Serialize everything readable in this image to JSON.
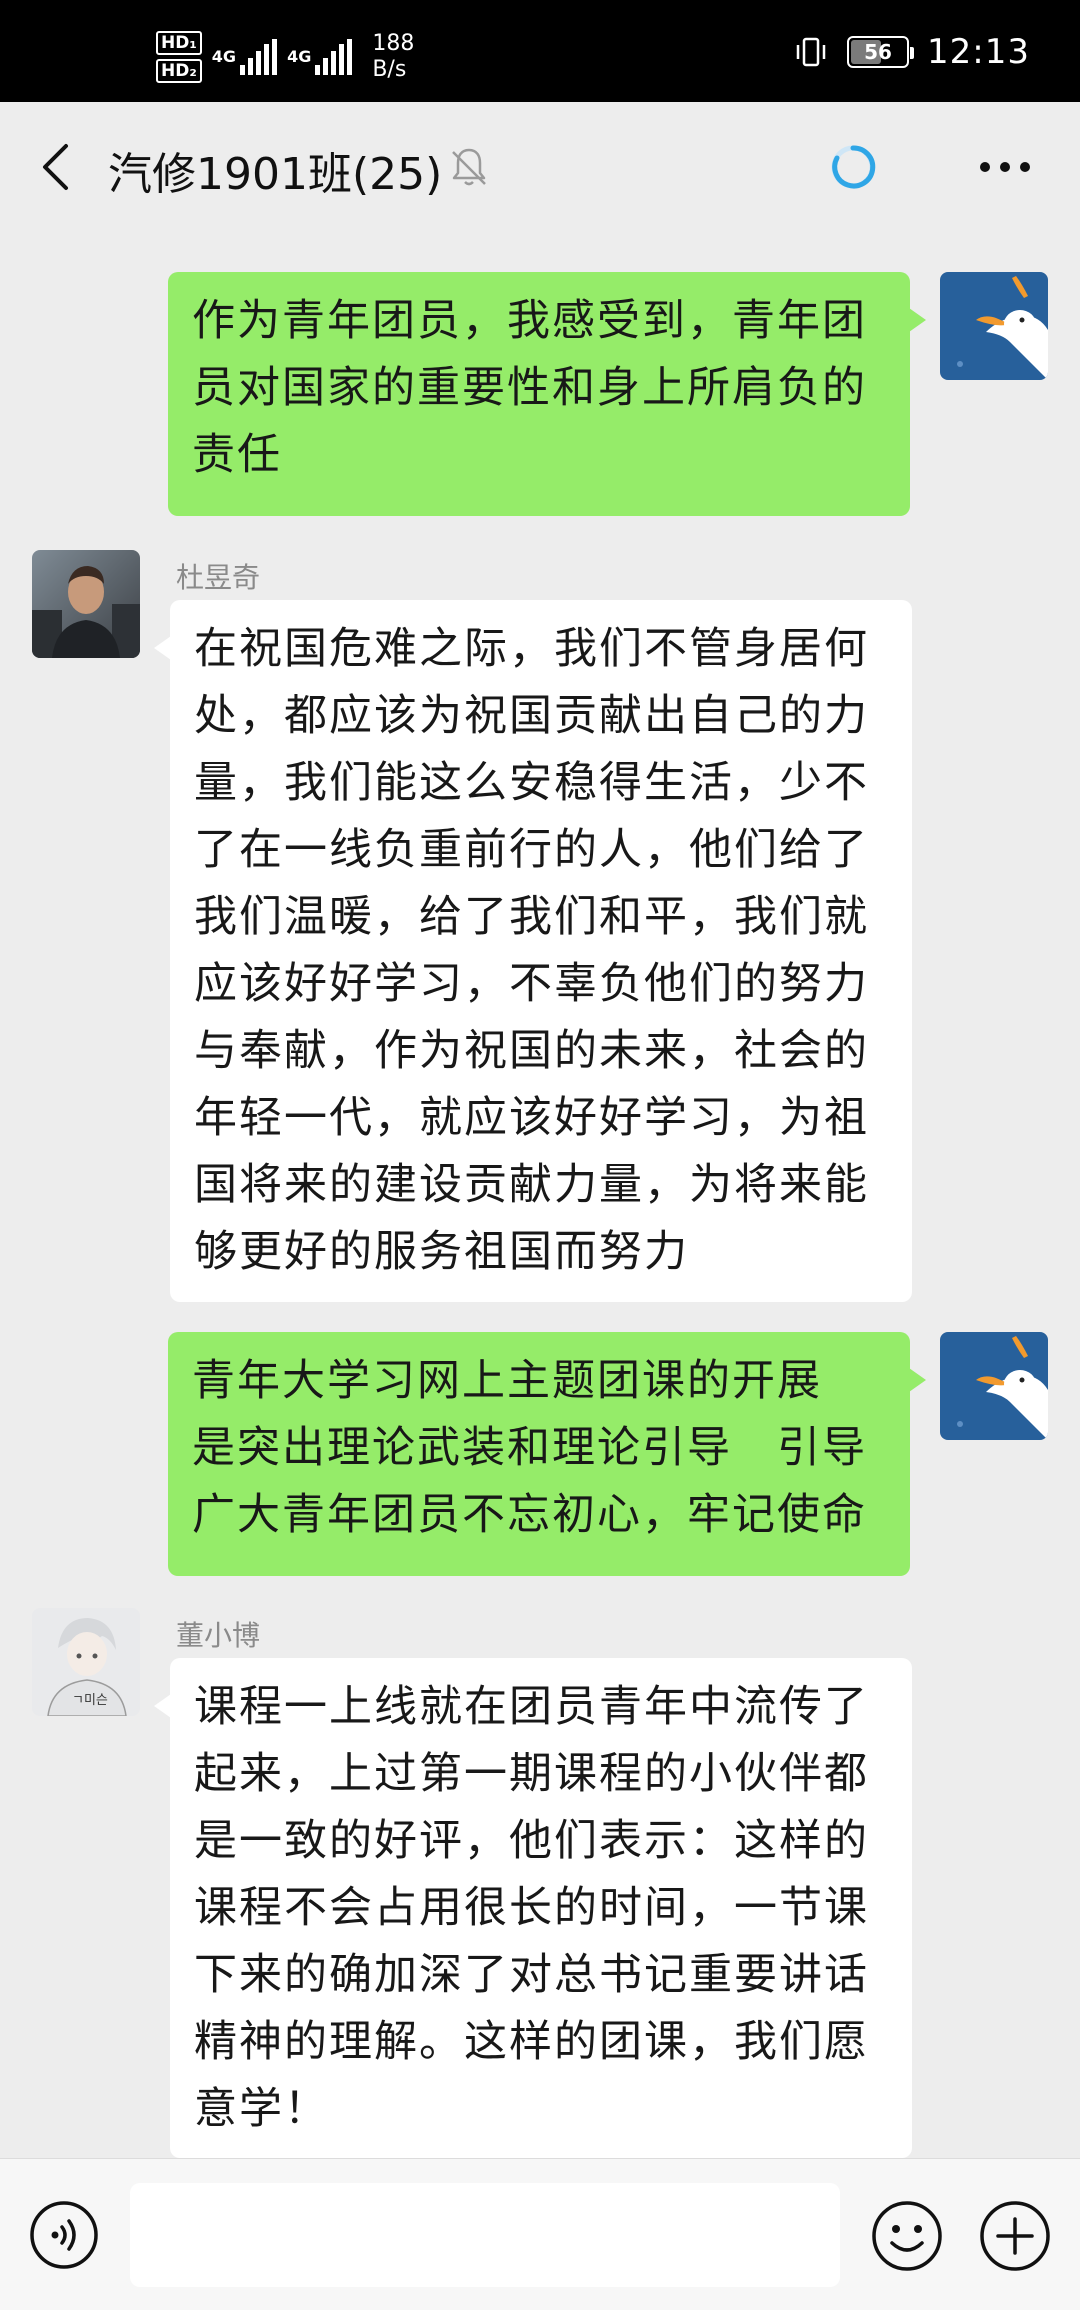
{
  "status_bar": {
    "hd1": "HD₁",
    "hd2": "HD₂",
    "net1": "4G",
    "net2": "4G",
    "speed_value": "188",
    "speed_unit": "B/s",
    "battery": "56",
    "battery_level_percent": 56,
    "time": "12:13"
  },
  "title_bar": {
    "title": "汽修1901班(25)",
    "icons": {
      "back": "chevron-left-icon",
      "mute": "bell-off-icon",
      "loading": "loading-spinner-icon",
      "more": "more-dots-icon"
    },
    "accent_color": "#1aad19"
  },
  "messages": [
    {
      "side": "self",
      "avatar": "duck-avatar",
      "lines": [
        "作为青年团员，我感受到，青年团",
        "员对国家的重要性和身上所肩负的",
        "责任"
      ]
    },
    {
      "side": "other",
      "sender": "杜昱奇",
      "avatar": "man-portrait-avatar",
      "lines": [
        "在祝国危难之际，我们不管身居何",
        "处，都应该为祝国贡献出自己的力",
        "量，我们能这么安稳得生活，少不",
        "了在一线负重前行的人，他们给了",
        "我们温暖，给了我们和平，我们就",
        "应该好好学习，不辜负他们的努力",
        "与奉献，作为祝国的未来，社会的",
        "年轻一代，就应该好好学习，为祖",
        "国将来的建设贡献力量，为将来能",
        "够更好的服务祖国而努力"
      ]
    },
    {
      "side": "self",
      "avatar": "duck-avatar",
      "lines": [
        "青年大学习网上主题团课的开展",
        "是突出理论武装和理论引导　引导",
        "广大青年团员不忘初心，牢记使命"
      ]
    },
    {
      "side": "other",
      "sender": "董小博",
      "avatar": "anime-boy-avatar",
      "lines": [
        "课程一上线就在团员青年中流传了",
        "起来，上过第一期课程的小伙伴都",
        "是一致的好评，他们表示：这样的",
        "课程不会占用很长的时间，一节课",
        "下来的确加深了对总书记重要讲话",
        "精神的理解。这样的团课，我们愿",
        "意学！"
      ]
    }
  ],
  "input_bar": {
    "value": "",
    "placeholder": "",
    "icons": {
      "voice": "voice-icon",
      "emoji": "emoji-icon",
      "plus": "plus-icon"
    }
  },
  "colors": {
    "self_bubble": "#95ec69",
    "other_bubble": "#ffffff",
    "background": "#ededed"
  }
}
